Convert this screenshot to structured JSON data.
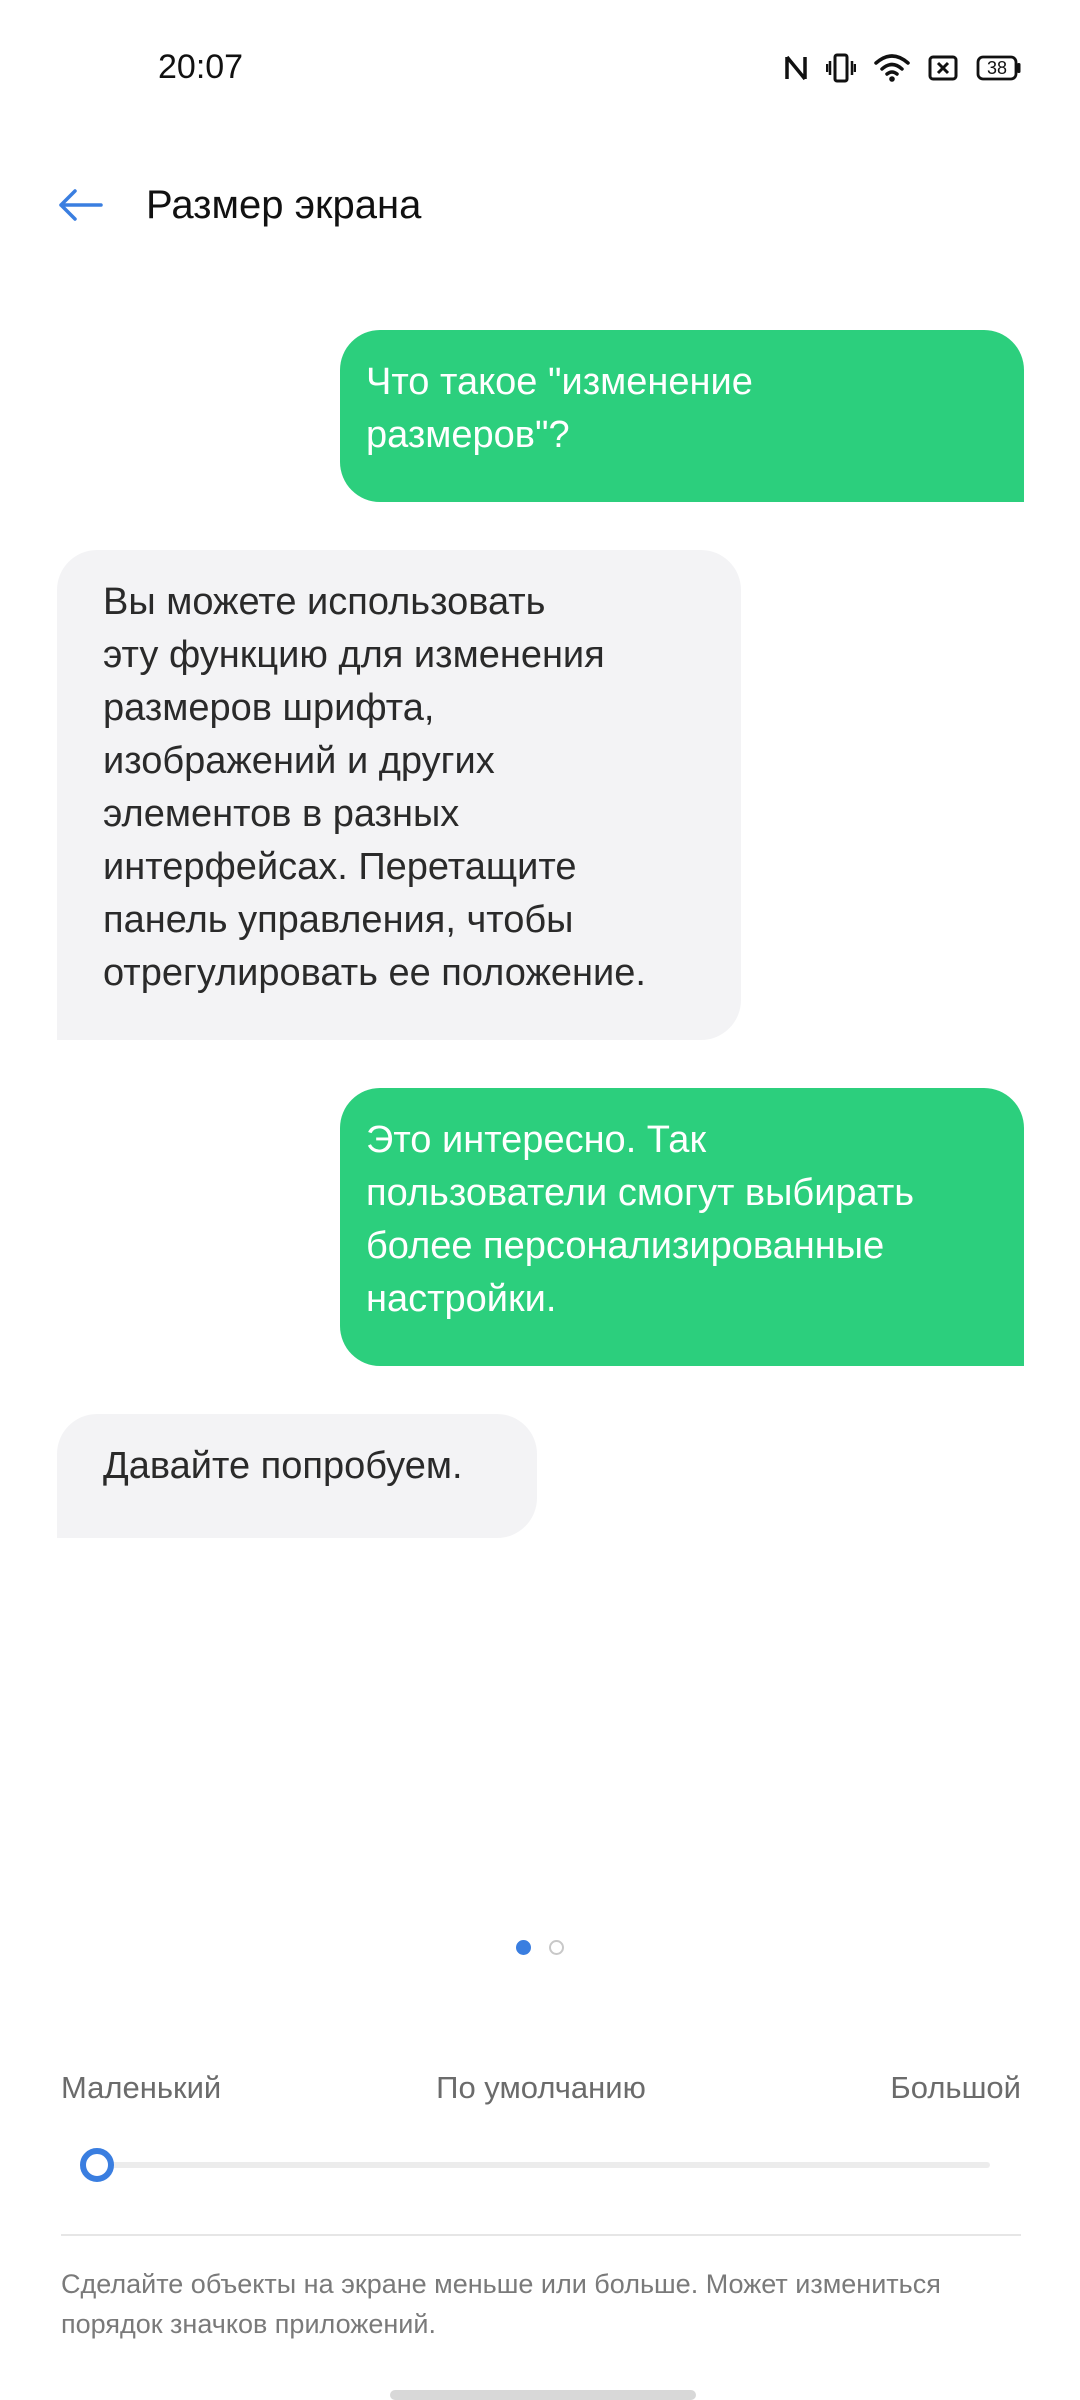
{
  "status_bar": {
    "time": "20:07",
    "battery": "38",
    "icons": [
      "nfc-icon",
      "vibrate-icon",
      "wifi-icon",
      "close-box-icon",
      "battery-icon"
    ]
  },
  "header": {
    "title": "Размер экрана",
    "back_icon": "arrow-left-icon"
  },
  "chat": {
    "messages": [
      {
        "side": "out",
        "text": "Что такое \"изменение\nразмеров\"?"
      },
      {
        "side": "in",
        "text": "Вы можете использовать\nэту функцию для изменения\nразмеров шрифта,\nизображений и других\nэлементов в разных\nинтерфейсах. Перетащите\nпанель управления, чтобы\nотрегулировать ее положение."
      },
      {
        "side": "out",
        "text": "Это интересно. Так\nпользователи смогут выбирать\nболее персонализированные\nнастройки."
      },
      {
        "side": "in",
        "text": "Давайте попробуем."
      }
    ]
  },
  "pager": {
    "pages": 2,
    "current": 1
  },
  "size_control": {
    "label_small": "Маленький",
    "label_default": "По умолчанию",
    "label_large": "Большой",
    "value": 0,
    "min": 0,
    "max": 1
  },
  "description": "Сделайте объекты на экране меньше или больше. Может измениться порядок значков приложений.",
  "colors": {
    "accent": "#3a7ee0",
    "bubble_out": "#2ccf7d",
    "bubble_in": "#f3f3f5"
  }
}
